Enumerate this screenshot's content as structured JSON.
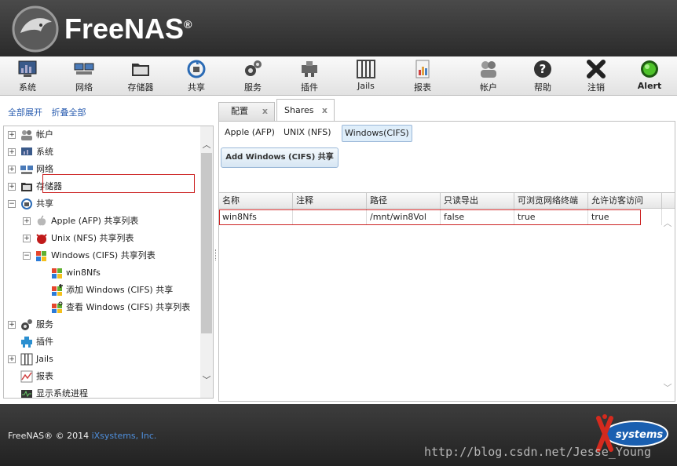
{
  "header": {
    "title": "FreeNAS",
    "trademark": "®"
  },
  "toolbar": {
    "items": [
      {
        "label": "系统",
        "icon": "system-icon"
      },
      {
        "label": "网络",
        "icon": "network-icon"
      },
      {
        "label": "存储器",
        "icon": "storage-icon"
      },
      {
        "label": "共享",
        "icon": "sharing-icon"
      },
      {
        "label": "服务",
        "icon": "services-icon"
      },
      {
        "label": "插件",
        "icon": "plugins-icon"
      },
      {
        "label": "Jails",
        "icon": "jails-icon"
      },
      {
        "label": "报表",
        "icon": "reporting-icon"
      },
      {
        "label": "帐户",
        "icon": "account-icon"
      },
      {
        "label": "帮助",
        "icon": "help-icon"
      },
      {
        "label": "注销",
        "icon": "logout-icon"
      },
      {
        "label": "Alert",
        "icon": "alert-icon"
      }
    ]
  },
  "left": {
    "expand_all": "全部展开",
    "collapse_all": "折叠全部",
    "tree": [
      {
        "label": "帐户",
        "icon": "account-icon",
        "expander": "+"
      },
      {
        "label": "系统",
        "icon": "system-icon",
        "expander": "+"
      },
      {
        "label": "网络",
        "icon": "network-icon",
        "expander": "+"
      },
      {
        "label": "存储器",
        "icon": "storage-icon",
        "expander": "+"
      },
      {
        "label": "共享",
        "icon": "sharing-icon",
        "expander": "−"
      },
      {
        "label": "Apple (AFP) 共享列表",
        "icon": "apple-icon",
        "expander": "+"
      },
      {
        "label": "Unix (NFS) 共享列表",
        "icon": "freebsd-icon",
        "expander": "+"
      },
      {
        "label": "Windows (CIFS) 共享列表",
        "icon": "windows-icon",
        "expander": "−"
      },
      {
        "label": "win8Nfs",
        "icon": "windows-icon",
        "expander": ""
      },
      {
        "label": "添加 Windows (CIFS) 共享",
        "icon": "windows-add-icon",
        "expander": ""
      },
      {
        "label": "查看 Windows (CIFS) 共享列表",
        "icon": "windows-view-icon",
        "expander": ""
      },
      {
        "label": "服务",
        "icon": "services-icon",
        "expander": "+"
      },
      {
        "label": "插件",
        "icon": "plugins-icon",
        "expander": ""
      },
      {
        "label": "Jails",
        "icon": "jails-icon",
        "expander": "+"
      },
      {
        "label": "报表",
        "icon": "reporting-icon",
        "expander": ""
      },
      {
        "label": "显示系统进程",
        "icon": "process-icon",
        "expander": ""
      }
    ]
  },
  "tabs": [
    {
      "label": "配置",
      "close": "x"
    },
    {
      "label": "Shares",
      "close": "x"
    }
  ],
  "subtabs": [
    "Apple (AFP)",
    "UNIX (NFS)",
    "Windows(CIFS)"
  ],
  "add_button": "Add Windows (CIFS) 共享",
  "grid": {
    "columns": [
      "名称",
      "注释",
      "路径",
      "只读导出",
      "可浏览网络终端",
      "允许访客访问"
    ],
    "rows": [
      [
        "win8Nfs",
        "",
        "/mnt/win8Vol",
        "false",
        "true",
        "true"
      ]
    ]
  },
  "footer": {
    "copyright": "FreeNAS® © 2014 ",
    "company": "iXsystems, Inc.",
    "logo_text": "systems",
    "watermark": "http://blog.csdn.net/Jesse_Young"
  },
  "colors": {
    "link": "#2a5db0",
    "highlight": "#cc2222",
    "alert_green": "#4ec22a"
  }
}
